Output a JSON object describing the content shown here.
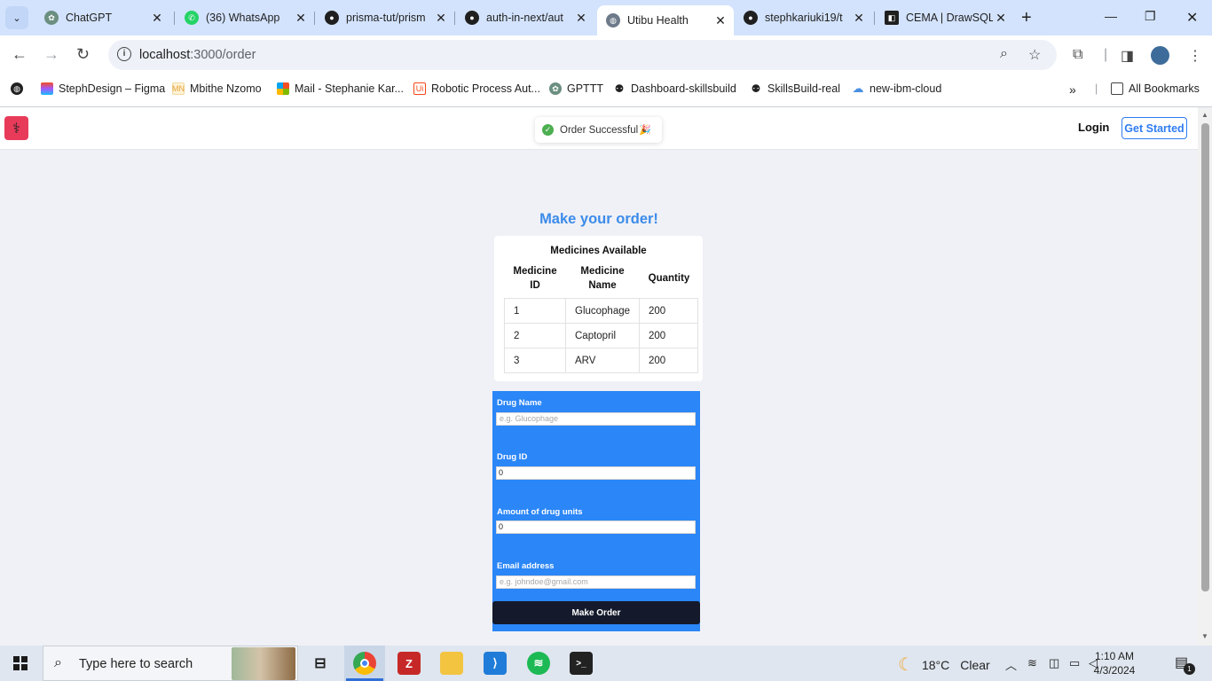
{
  "browser": {
    "tabs": [
      {
        "title": "ChatGPT",
        "icon": "chatgpt-icon"
      },
      {
        "title": "(36) WhatsApp",
        "icon": "whatsapp-icon"
      },
      {
        "title": "prisma-tut/prism",
        "icon": "github-icon"
      },
      {
        "title": "auth-in-next/aut",
        "icon": "github-icon"
      },
      {
        "title": "Utibu Health",
        "icon": "globe-icon",
        "active": true
      },
      {
        "title": "stephkariuki19/t",
        "icon": "github-icon"
      },
      {
        "title": "CEMA | DrawSQL",
        "icon": "drawsql-icon"
      }
    ],
    "url_host": "localhost",
    "url_path": ":3000/order",
    "bookmarks": [
      {
        "label": "StephDesign – Figma",
        "icon": "figma-icon"
      },
      {
        "label": "Mbithe Nzomo",
        "icon": "mn-icon"
      },
      {
        "label": "Mail - Stephanie Kar...",
        "icon": "microsoft-icon"
      },
      {
        "label": "Robotic Process Aut...",
        "icon": "uipath-icon"
      },
      {
        "label": "GPTTT",
        "icon": "chatgpt-icon"
      },
      {
        "label": "Dashboard-skillsbuild",
        "icon": "skillsbuild-icon"
      },
      {
        "label": "SkillsBuild-real",
        "icon": "skillsbuild-icon"
      },
      {
        "label": "new-ibm-cloud",
        "icon": "cloud-icon"
      }
    ],
    "all_bookmarks_label": "All Bookmarks"
  },
  "app": {
    "nav": {
      "login": "Login",
      "get_started": "Get Started"
    },
    "toast": {
      "message": "Order Successful",
      "emoji": "🎉"
    },
    "page_title": "Make your order!",
    "medicines": {
      "caption": "Medicines Available",
      "headers": [
        "Medicine ID",
        "Medicine Name",
        "Quantity"
      ],
      "header_lines": [
        [
          "Medicine",
          "ID"
        ],
        [
          "Medicine",
          "Name"
        ],
        [
          "Quantity"
        ]
      ],
      "rows": [
        {
          "id": "1",
          "name": "Glucophage",
          "quantity": "200"
        },
        {
          "id": "2",
          "name": "Captopril",
          "quantity": "200"
        },
        {
          "id": "3",
          "name": "ARV",
          "quantity": "200"
        }
      ]
    },
    "form": {
      "drug_name": {
        "label": "Drug Name",
        "placeholder": "e.g. Glucophage",
        "value": ""
      },
      "drug_id": {
        "label": "Drug ID",
        "value": "0"
      },
      "amount": {
        "label": "Amount of drug units",
        "value": "0"
      },
      "email": {
        "label": "Email address",
        "placeholder": "e.g. johndoe@gmail.com",
        "value": ""
      },
      "submit_label": "Make Order"
    }
  },
  "taskbar": {
    "search_placeholder": "Type here to search",
    "weather": {
      "temp": "18°C",
      "condition": "Clear"
    },
    "time": "1:10 AM",
    "date": "4/3/2024",
    "notification_count": "1"
  },
  "colors": {
    "accent": "#2b86f7",
    "title": "#3b8bea",
    "logo": "#e83b5a",
    "submit": "#141a2c",
    "success": "#4caf50"
  }
}
